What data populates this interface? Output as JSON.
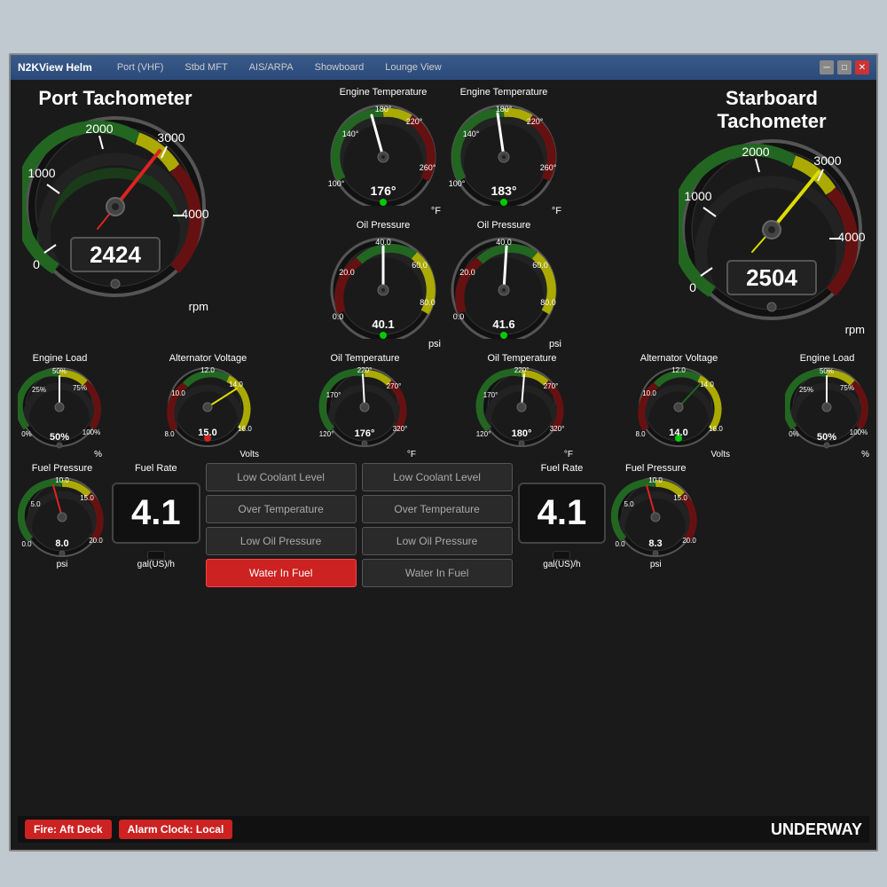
{
  "window": {
    "title": "N2KView Helm",
    "tabs": [
      "Port (VHF)",
      "Stbd MFT",
      "AIS/ARPA",
      "Showboard",
      "Lounge View"
    ],
    "controls": {
      "min": "─",
      "max": "□",
      "close": "✕"
    }
  },
  "port": {
    "tach_title": "Port Tachometer",
    "tach_rpm": "2424",
    "rpm_unit": "rpm",
    "engine_temp_label": "Engine Temperature",
    "engine_temp_val": "176°",
    "engine_temp_unit": "°F",
    "oil_pressure_label": "Oil Pressure",
    "oil_pressure_val": "40.1",
    "oil_pressure_unit": "psi",
    "oil_temp_label": "Oil Temperature",
    "oil_temp_val": "176°",
    "oil_temp_unit": "°F",
    "engine_load_label": "Engine Load",
    "engine_load_val": "50%",
    "engine_load_unit": "%",
    "alt_voltage_label": "Alternator Voltage",
    "alt_voltage_val": "15.0",
    "alt_voltage_unit": "Volts",
    "fuel_pressure_label": "Fuel Pressure",
    "fuel_pressure_val": "8.0",
    "fuel_pressure_unit": "psi",
    "fuel_rate_label": "Fuel Rate",
    "fuel_rate_val": "4.1",
    "fuel_rate_unit": "gal(US)/h"
  },
  "stbd": {
    "tach_title": "Starboard Tachometer",
    "tach_rpm": "2504",
    "rpm_unit": "rpm",
    "engine_temp_label": "Engine Temperature",
    "engine_temp_val": "183°",
    "engine_temp_unit": "°F",
    "oil_pressure_label": "Oil Pressure",
    "oil_pressure_val": "41.6",
    "oil_pressure_unit": "psi",
    "oil_temp_label": "Oil Temperature",
    "oil_temp_val": "180°",
    "oil_temp_unit": "°F",
    "engine_load_label": "Engine Load",
    "engine_load_val": "50%",
    "engine_load_unit": "%",
    "alt_voltage_label": "Alternator Voltage",
    "alt_voltage_val": "14.0",
    "alt_voltage_unit": "Volts",
    "fuel_pressure_label": "Fuel Pressure",
    "fuel_pressure_val": "8.3",
    "fuel_pressure_unit": "psi",
    "fuel_rate_label": "Fuel Rate",
    "fuel_rate_val": "4.1",
    "fuel_rate_unit": "gal(US)/h"
  },
  "alarms": {
    "port": {
      "low_coolant": "Low Coolant Level",
      "over_temp": "Over Temperature",
      "low_oil": "Low Oil Pressure",
      "water_fuel": "Water In Fuel"
    },
    "stbd": {
      "low_coolant": "Low Coolant Level",
      "over_temp": "Over Temperature",
      "low_oil": "Low Oil Pressure",
      "water_fuel": "Water In Fuel"
    },
    "water_fuel_active": true
  },
  "status_bar": {
    "fire_label": "Fire: Aft Deck",
    "alarm_label": "Alarm Clock: Local",
    "underway": "UNDERWAY"
  }
}
